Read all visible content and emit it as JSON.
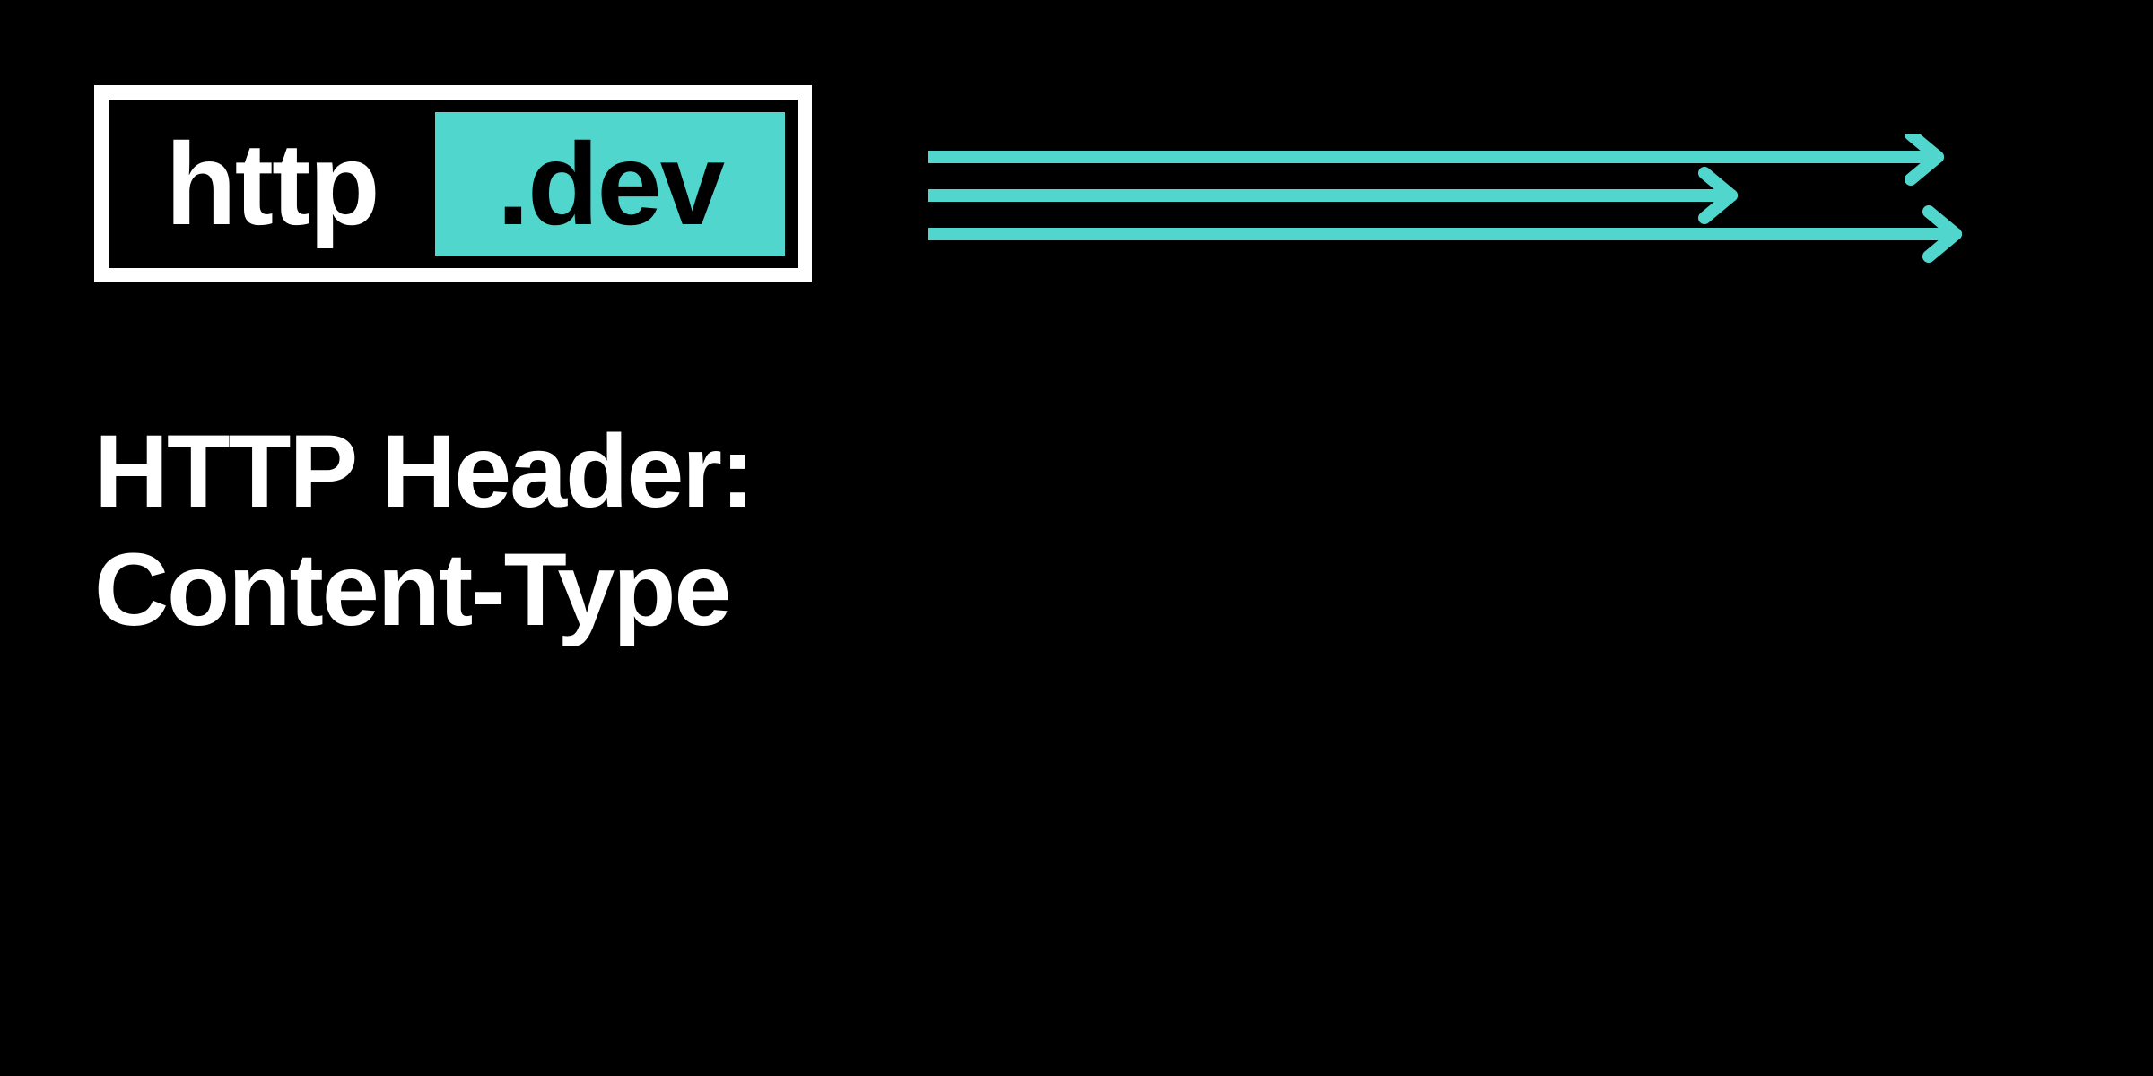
{
  "logo": {
    "left_text": "http",
    "right_text": ".dev"
  },
  "heading": {
    "line1": "HTTP Header:",
    "line2": "Content-Type"
  },
  "colors": {
    "accent": "#51d6ce",
    "background": "#000000",
    "foreground": "#ffffff"
  },
  "icons": {
    "arrows_count": 3
  }
}
